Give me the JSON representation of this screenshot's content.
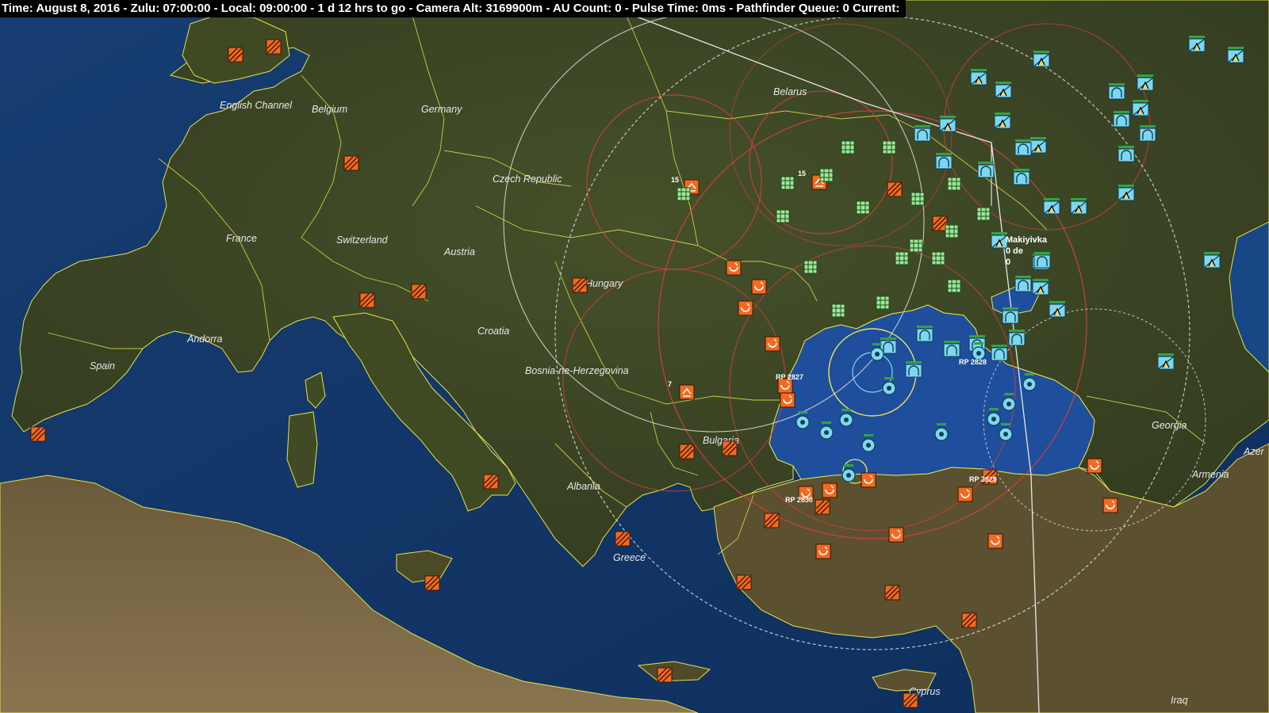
{
  "status_bar": {
    "text": "Time: August 8, 2016 - Zulu: 07:00:00 - Local: 09:00:00 - 1 d 12 hrs to go -  Camera Alt: 3169900m - AU Count: 0 - Pulse Time: 0ms - Pathfinder Queue: 0 Current:"
  },
  "map": {
    "place_labels": {
      "english_channel": "English Channel",
      "belgium": "Belgium",
      "germany": "Germany",
      "belarus": "Belarus",
      "czech_republic": "Czech Republic",
      "france": "France",
      "switzerland": "Switzerland",
      "austria": "Austria",
      "hungary": "Hungary",
      "andorra": "Andorra",
      "croatia": "Croatia",
      "bosnia": "Bosnia-ne-Herzegovina",
      "spain": "Spain",
      "bulgaria": "Bulgaria",
      "albania": "Albania",
      "greece": "Greece",
      "georgia": "Georgia",
      "armenia": "Armenia",
      "azer": "Azer",
      "cyprus": "Cyprus",
      "iraq": "Iraq"
    },
    "unit_labels": {
      "makiyivka": "Makiyivka",
      "makiyivka_sub1": "0 de",
      "makiyivka_sub2": "0",
      "count_15a": "15",
      "count_15b": "15",
      "count_7": "7",
      "rp_2827": "RP 2827",
      "rp_2828": "RP 2828",
      "rp_2829": "RP 2829",
      "rp_2830": "RP 2830"
    },
    "colors": {
      "land": "#3b4424",
      "sea": "#153a6e",
      "border": "#e6e24a",
      "hostile": "#f26a22",
      "friendly_green": "#9ee89a",
      "friendly_cyan": "#7fd6f0",
      "range_ring_red": "#d84040",
      "range_ring_white": "#e8e8e8"
    }
  }
}
